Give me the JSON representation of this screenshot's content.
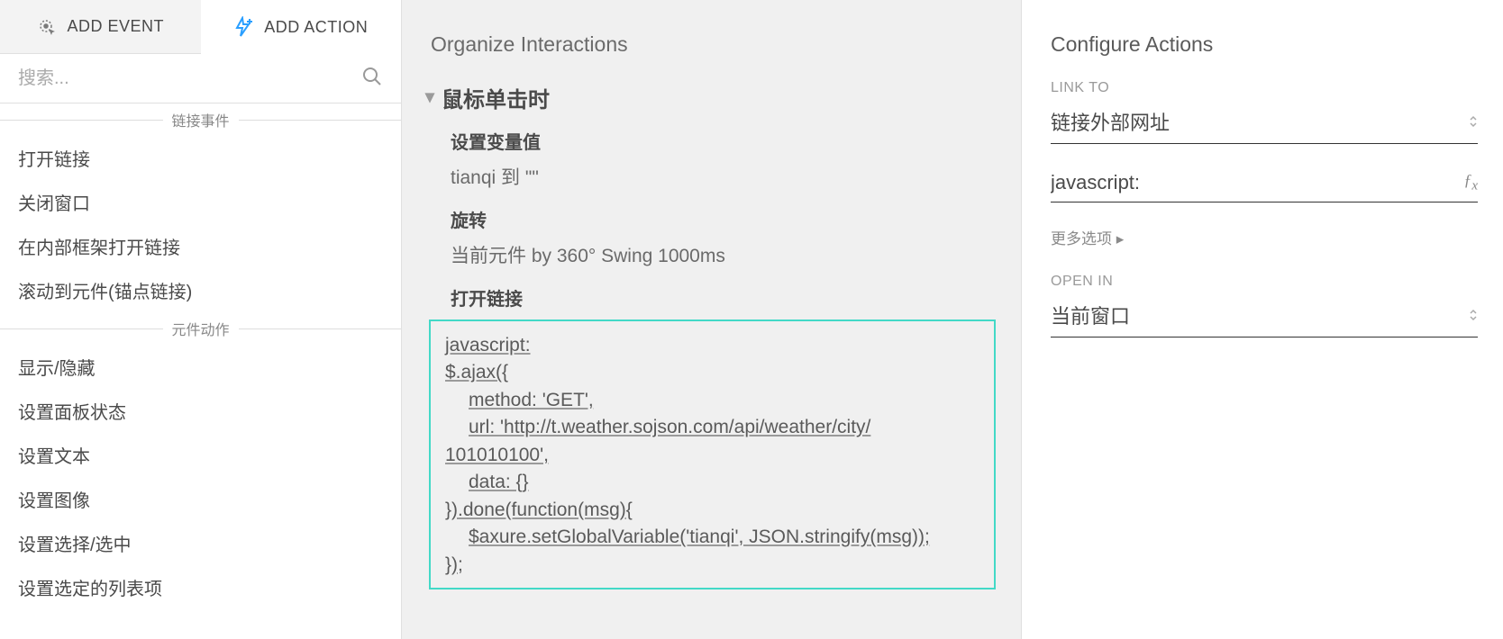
{
  "left": {
    "tabs": {
      "add_event": "ADD EVENT",
      "add_action": "ADD ACTION"
    },
    "search_placeholder": "搜索...",
    "sections": [
      {
        "label": "链接事件",
        "items": [
          "打开链接",
          "关闭窗口",
          "在内部框架打开链接",
          "滚动到元件(锚点链接)"
        ]
      },
      {
        "label": "元件动作",
        "items": [
          "显示/隐藏",
          "设置面板状态",
          "设置文本",
          "设置图像",
          "设置选择/选中",
          "设置选定的列表项"
        ]
      }
    ]
  },
  "middle": {
    "title": "Organize Interactions",
    "event_name": "鼠标单击时",
    "actions": [
      {
        "title": "设置变量值",
        "detail": "tianqi 到 \"\""
      },
      {
        "title": "旋转",
        "detail": "当前元件 by 360° Swing 1000ms"
      },
      {
        "title": "打开链接"
      }
    ],
    "code_lines": {
      "l1": "javascript:",
      "l2": "$.ajax({",
      "l3": "method: 'GET',",
      "l4": "url: 'http://t.weather.sojson.com/api/weather/city/",
      "l5": "101010100',",
      "l6": "data: {}",
      "l7": "}).done(function(msg){",
      "l8": "$axure.setGlobalVariable('tianqi', JSON.stringify(msg));",
      "l9_a": "})",
      "l9_b": ";"
    }
  },
  "right": {
    "title": "Configure Actions",
    "link_to_label": "LINK TO",
    "link_to_value": "链接外部网址",
    "url_value": "javascript:",
    "more_options": "更多选项 ▸",
    "open_in_label": "OPEN IN",
    "open_in_value": "当前窗口"
  }
}
